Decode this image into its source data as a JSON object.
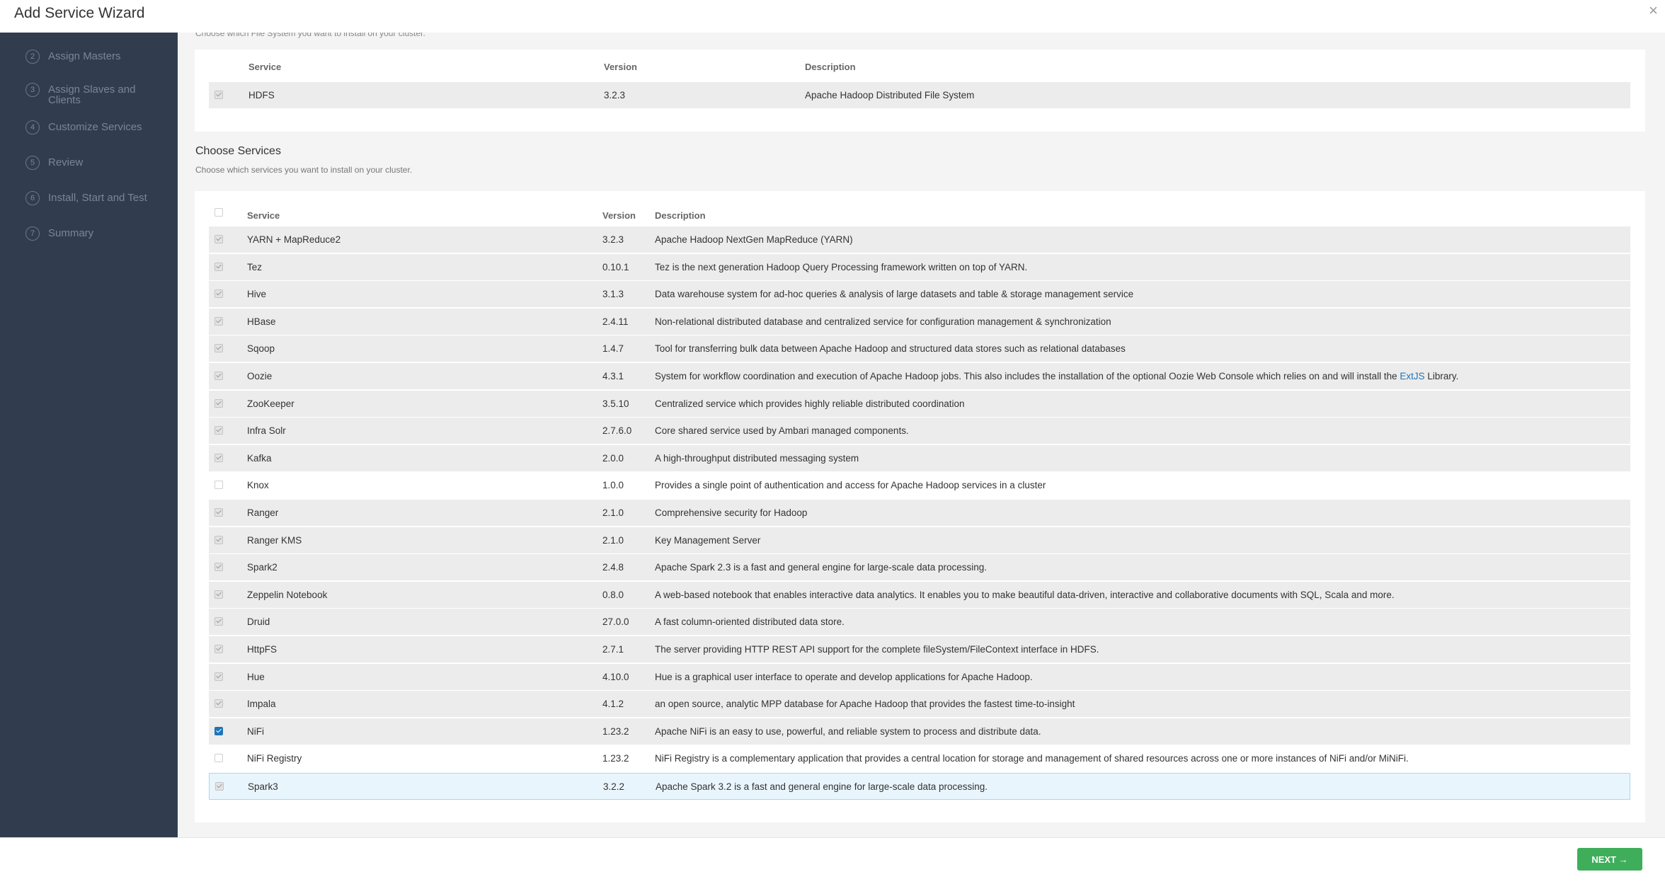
{
  "header": {
    "title": "Add Service Wizard",
    "close_glyph": "×"
  },
  "sidebar": {
    "steps": [
      {
        "num": "2",
        "label": "Assign Masters"
      },
      {
        "num": "3",
        "label": "Assign Slaves and Clients"
      },
      {
        "num": "4",
        "label": "Customize Services"
      },
      {
        "num": "5",
        "label": "Review"
      },
      {
        "num": "6",
        "label": "Install, Start and Test"
      },
      {
        "num": "7",
        "label": "Summary"
      }
    ]
  },
  "filesystem": {
    "cut_subtitle": "Choose which File System you want to install on your cluster.",
    "columns": {
      "service": "Service",
      "version": "Version",
      "description": "Description"
    },
    "rows": [
      {
        "service": "HDFS",
        "version": "3.2.3",
        "description": "Apache Hadoop Distributed File System",
        "state": "disabled-checked"
      }
    ]
  },
  "services": {
    "title": "Choose Services",
    "subtitle": "Choose which services you want to install on your cluster.",
    "columns": {
      "service": "Service",
      "version": "Version",
      "description": "Description"
    },
    "oozie_desc_pre": "System for workflow coordination and execution of Apache Hadoop jobs. This also includes the installation of the optional Oozie Web Console which relies on and will install the ",
    "oozie_link": "ExtJS",
    "oozie_desc_post": " Library.",
    "rows": [
      {
        "service": "YARN + MapReduce2",
        "version": "3.2.3",
        "description": "Apache Hadoop NextGen MapReduce (YARN)",
        "state": "disabled-checked"
      },
      {
        "service": "Tez",
        "version": "0.10.1",
        "description": "Tez is the next generation Hadoop Query Processing framework written on top of YARN.",
        "state": "disabled-checked"
      },
      {
        "service": "Hive",
        "version": "3.1.3",
        "description": "Data warehouse system for ad-hoc queries & analysis of large datasets and table & storage management service",
        "state": "disabled-checked"
      },
      {
        "service": "HBase",
        "version": "2.4.11",
        "description": "Non-relational distributed database and centralized service for configuration management & synchronization",
        "state": "disabled-checked"
      },
      {
        "service": "Sqoop",
        "version": "1.4.7",
        "description": "Tool for transferring bulk data between Apache Hadoop and structured data stores such as relational databases",
        "state": "disabled-checked"
      },
      {
        "service": "Oozie",
        "version": "4.3.1",
        "description": "",
        "state": "disabled-checked"
      },
      {
        "service": "ZooKeeper",
        "version": "3.5.10",
        "description": "Centralized service which provides highly reliable distributed coordination",
        "state": "disabled-checked"
      },
      {
        "service": "Infra Solr",
        "version": "2.7.6.0",
        "description": "Core shared service used by Ambari managed components.",
        "state": "disabled-checked"
      },
      {
        "service": "Kafka",
        "version": "2.0.0",
        "description": "A high-throughput distributed messaging system",
        "state": "disabled-checked"
      },
      {
        "service": "Knox",
        "version": "1.0.0",
        "description": "Provides a single point of authentication and access for Apache Hadoop services in a cluster",
        "state": "unchecked"
      },
      {
        "service": "Ranger",
        "version": "2.1.0",
        "description": "Comprehensive security for Hadoop",
        "state": "disabled-checked"
      },
      {
        "service": "Ranger KMS",
        "version": "2.1.0",
        "description": "Key Management Server",
        "state": "disabled-checked"
      },
      {
        "service": "Spark2",
        "version": "2.4.8",
        "description": "Apache Spark 2.3 is a fast and general engine for large-scale data processing.",
        "state": "disabled-checked"
      },
      {
        "service": "Zeppelin Notebook",
        "version": "0.8.0",
        "description": "A web-based notebook that enables interactive data analytics. It enables you to make beautiful data-driven, interactive and collaborative documents with SQL, Scala and more.",
        "state": "disabled-checked"
      },
      {
        "service": "Druid",
        "version": "27.0.0",
        "description": "A fast column-oriented distributed data store.",
        "state": "disabled-checked"
      },
      {
        "service": "HttpFS",
        "version": "2.7.1",
        "description": "The server providing HTTP REST API support for the complete fileSystem/FileContext interface in HDFS.",
        "state": "disabled-checked"
      },
      {
        "service": "Hue",
        "version": "4.10.0",
        "description": "Hue is a graphical user interface to operate and develop applications for Apache Hadoop.",
        "state": "disabled-checked"
      },
      {
        "service": "Impala",
        "version": "4.1.2",
        "description": "an open source, analytic MPP database for Apache Hadoop that provides the fastest time-to-insight",
        "state": "disabled-checked"
      },
      {
        "service": "NiFi",
        "version": "1.23.2",
        "description": "Apache NiFi is an easy to use, powerful, and reliable system to process and distribute data.",
        "state": "checked"
      },
      {
        "service": "NiFi Registry",
        "version": "1.23.2",
        "description": "NiFi Registry is a complementary application that provides a central location for storage and management of shared resources across one or more instances of NiFi and/or MiNiFi.",
        "state": "unchecked"
      },
      {
        "service": "Spark3",
        "version": "3.2.2",
        "description": "Apache Spark 3.2 is a fast and general engine for large-scale data processing.",
        "state": "disabled-checked"
      }
    ]
  },
  "footer": {
    "next_label": "NEXT →"
  },
  "colors": {
    "sidebar": "#313d4f",
    "accent": "#1f75b8",
    "next": "#3fae5b"
  }
}
